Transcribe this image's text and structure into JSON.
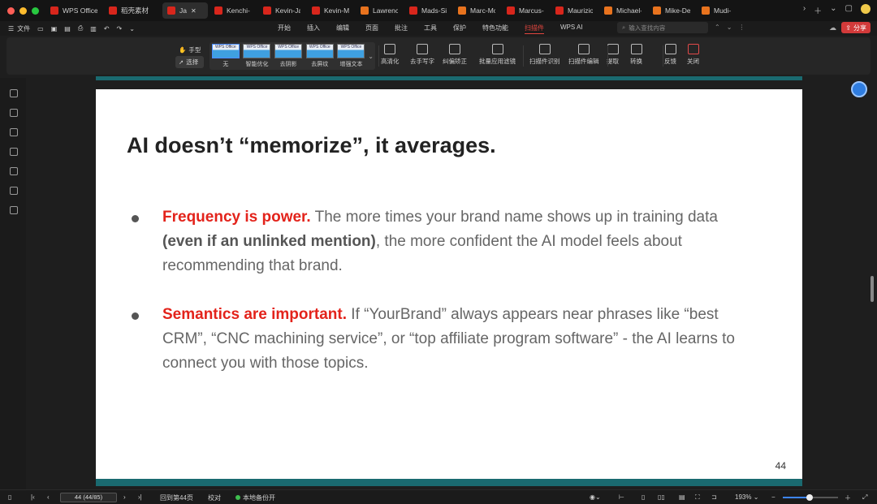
{
  "tabs": [
    {
      "label": "WPS Office",
      "icon": "wps-logo-icon",
      "color": "#d8261c"
    },
    {
      "label": "稻壳素材",
      "icon": "docer-icon",
      "color": "#d8261c"
    },
    {
      "label": "Ja",
      "icon": "pdf-icon",
      "color": "#d8261c",
      "active": true
    },
    {
      "label": "Kenchi-",
      "icon": "pdf-icon",
      "color": "#d8261c"
    },
    {
      "label": "Kevin-Ja",
      "icon": "pdf-icon",
      "color": "#d8261c"
    },
    {
      "label": "Kevin-M",
      "icon": "pdf-icon",
      "color": "#d8261c"
    },
    {
      "label": "Lawrenc",
      "icon": "ppt-icon",
      "color": "#e8731e"
    },
    {
      "label": "Mads-Si",
      "icon": "pdf-icon",
      "color": "#d8261c"
    },
    {
      "label": "Marc-Mc",
      "icon": "ppt-icon",
      "color": "#e8731e"
    },
    {
      "label": "Marcus-",
      "icon": "pdf-icon",
      "color": "#d8261c"
    },
    {
      "label": "Maurizio",
      "icon": "pdf-icon",
      "color": "#d8261c"
    },
    {
      "label": "Michael-",
      "icon": "ppt-icon",
      "color": "#e8731e"
    },
    {
      "label": "Mike-De",
      "icon": "ppt-icon",
      "color": "#e8731e"
    },
    {
      "label": "Mudi-",
      "icon": "ppt-icon",
      "color": "#e8731e"
    }
  ],
  "menu": {
    "file": "文件",
    "items": [
      "开始",
      "插入",
      "编辑",
      "页面",
      "批注",
      "工具",
      "保护",
      "特色功能",
      "扫描件",
      "WPS AI"
    ],
    "active": "扫描件",
    "search_placeholder": "输入查找内容",
    "share": "分享"
  },
  "ribbon": {
    "hand": "手型",
    "select": "选择",
    "filters": [
      "无",
      "智能优化",
      "去阴影",
      "去屏纹",
      "增强文本"
    ],
    "thumb_text": "WPS Office",
    "buttons": [
      "高清化",
      "去手写字",
      "纠偏矫正",
      "批量应用滤镜",
      "扫描件识别",
      "扫描件编辑",
      "提取",
      "转换",
      "反馈",
      "关闭"
    ]
  },
  "slide": {
    "title": "AI doesn’t “memorize”, it averages.",
    "bullets": [
      {
        "highlight": "Frequency is power.",
        "text1": " The more times your brand name shows up in training data ",
        "bold": "(even if an unlinked mention)",
        "text2": ", the more confident the AI model feels about recommending that brand."
      },
      {
        "highlight": "Semantics are important.",
        "text1": " If “YourBrand” always appears near phrases like “best CRM”, “CNC machining service”, or “top affiliate program software” - the AI learns to connect you with those topics.",
        "bold": "",
        "text2": ""
      }
    ],
    "page_number": "44"
  },
  "status": {
    "page_input": "44 (44/85)",
    "goto": "回到第44页",
    "proof": "校对",
    "backup": "本地备份开",
    "zoom": "193%",
    "zoom_fraction": 0.48
  }
}
